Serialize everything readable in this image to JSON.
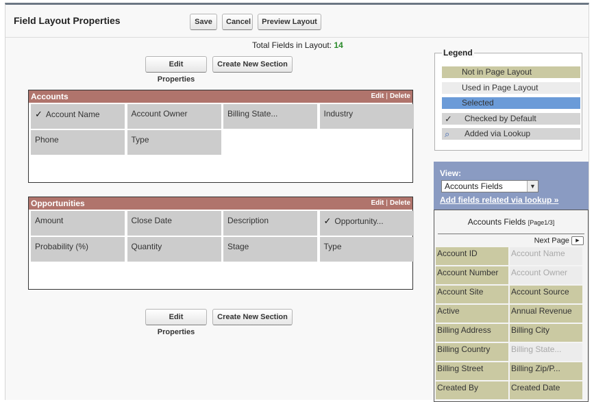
{
  "header": {
    "title": "Field Layout Properties",
    "buttons": {
      "save": "Save",
      "cancel": "Cancel",
      "preview": "Preview Layout"
    }
  },
  "total": {
    "label": "Total Fields in Layout:",
    "count": "14"
  },
  "toolbar": {
    "edit_properties": "Edit Properties",
    "create_section": "Create New Section"
  },
  "sections": [
    {
      "title": "Accounts",
      "edit": "Edit",
      "delete": "Delete",
      "fields": [
        {
          "label": "Account Name",
          "checked": true
        },
        {
          "label": "Account Owner",
          "checked": false
        },
        {
          "label": "Billing State...",
          "checked": false
        },
        {
          "label": "Industry",
          "checked": false
        },
        {
          "label": "Phone",
          "checked": false
        },
        {
          "label": "Type",
          "checked": false
        }
      ]
    },
    {
      "title": "Opportunities",
      "edit": "Edit",
      "delete": "Delete",
      "fields": [
        {
          "label": "Amount",
          "checked": false
        },
        {
          "label": "Close Date",
          "checked": false
        },
        {
          "label": "Description",
          "checked": false
        },
        {
          "label": "Opportunity...",
          "checked": true
        },
        {
          "label": "Probability (%)",
          "checked": false
        },
        {
          "label": "Quantity",
          "checked": false
        },
        {
          "label": "Stage",
          "checked": false
        },
        {
          "label": "Type",
          "checked": false
        }
      ]
    }
  ],
  "legend": {
    "title": "Legend",
    "items": [
      {
        "label": "Not in Page Layout",
        "color": "#cac9a2",
        "icon": ""
      },
      {
        "label": "Used in Page Layout",
        "color": "#ececec",
        "icon": ""
      },
      {
        "label": "Selected",
        "color": "#6b9bd8",
        "icon": ""
      },
      {
        "label": "Checked by Default",
        "color": "#d4d4d4",
        "icon": "check-icon"
      },
      {
        "label": "Added via Lookup",
        "color": "#d4d4d4",
        "icon": "magnifier-icon"
      }
    ]
  },
  "view": {
    "label": "View:",
    "selected": "Accounts Fields",
    "lookup_link": "Add fields related via lookup »"
  },
  "field_list": {
    "title": "Accounts Fields",
    "page_info": "[Page1/3]",
    "next_page": "Next Page",
    "rows": [
      [
        {
          "label": "Account ID",
          "used": false
        },
        {
          "label": "Account Name",
          "used": true
        }
      ],
      [
        {
          "label": "Account Number",
          "used": false
        },
        {
          "label": "Account Owner",
          "used": true
        }
      ],
      [
        {
          "label": "Account Site",
          "used": false
        },
        {
          "label": "Account Source",
          "used": false
        }
      ],
      [
        {
          "label": "Active",
          "used": false
        },
        {
          "label": "Annual Revenue",
          "used": false
        }
      ],
      [
        {
          "label": "Billing Address",
          "used": false
        },
        {
          "label": "Billing City",
          "used": false
        }
      ],
      [
        {
          "label": "Billing Country",
          "used": false
        },
        {
          "label": "Billing State...",
          "used": true
        }
      ],
      [
        {
          "label": "Billing Street",
          "used": false
        },
        {
          "label": "Billing Zip/P...",
          "used": false
        }
      ],
      [
        {
          "label": "Created By",
          "used": false
        },
        {
          "label": "Created Date",
          "used": false
        }
      ]
    ]
  }
}
